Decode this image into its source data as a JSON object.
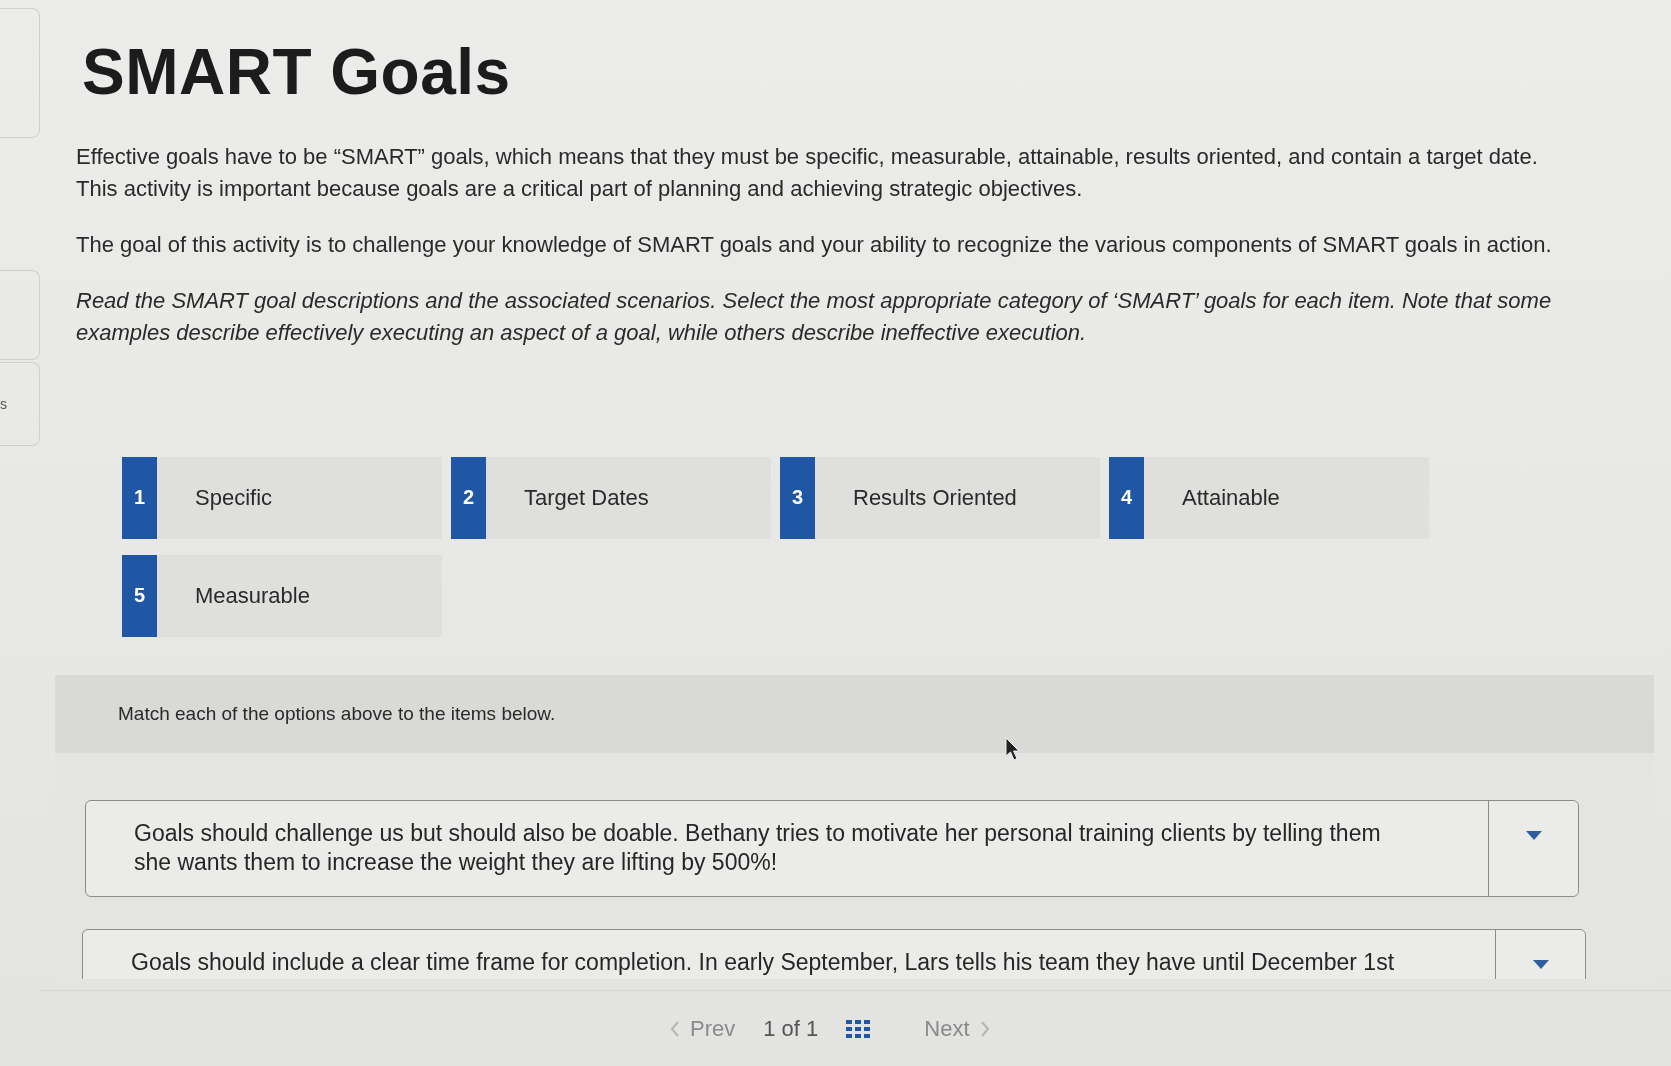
{
  "left_rail": {
    "label": "s"
  },
  "title": "SMART Goals",
  "intro": [
    {
      "text": "Effective goals have to be “SMART” goals, which means that they must be specific, measurable, attainable, results oriented, and contain a target date. This activity is important because goals are a critical part of planning and achieving strategic objectives.",
      "italic": false
    },
    {
      "text": "The goal of this activity is to challenge your knowledge of SMART goals and your ability to recognize the various components of SMART goals in action.",
      "italic": false
    },
    {
      "text": "Read the SMART goal descriptions and the associated scenarios. Select the most appropriate category of ‘SMART’ goals for each item. Note that some examples describe effectively executing an aspect of a goal, while others describe ineffective execution.",
      "italic": true
    }
  ],
  "options": [
    {
      "number": "1",
      "label": "Specific"
    },
    {
      "number": "2",
      "label": "Target Dates"
    },
    {
      "number": "3",
      "label": "Results Oriented"
    },
    {
      "number": "4",
      "label": "Attainable"
    },
    {
      "number": "5",
      "label": "Measurable"
    }
  ],
  "match": {
    "prompt": "Match each of the options above to the items below.",
    "items": [
      {
        "text": "Goals should challenge us but should also be doable. Bethany tries to motivate her personal training clients by telling them she wants them to increase the weight they are lifting by 500%!"
      },
      {
        "text": "Goals should include a clear time frame for completion. In early September, Lars tells his team they have until December 1st"
      }
    ]
  },
  "pager": {
    "prev": "Prev",
    "page": "1 of 1",
    "next": "Next"
  }
}
